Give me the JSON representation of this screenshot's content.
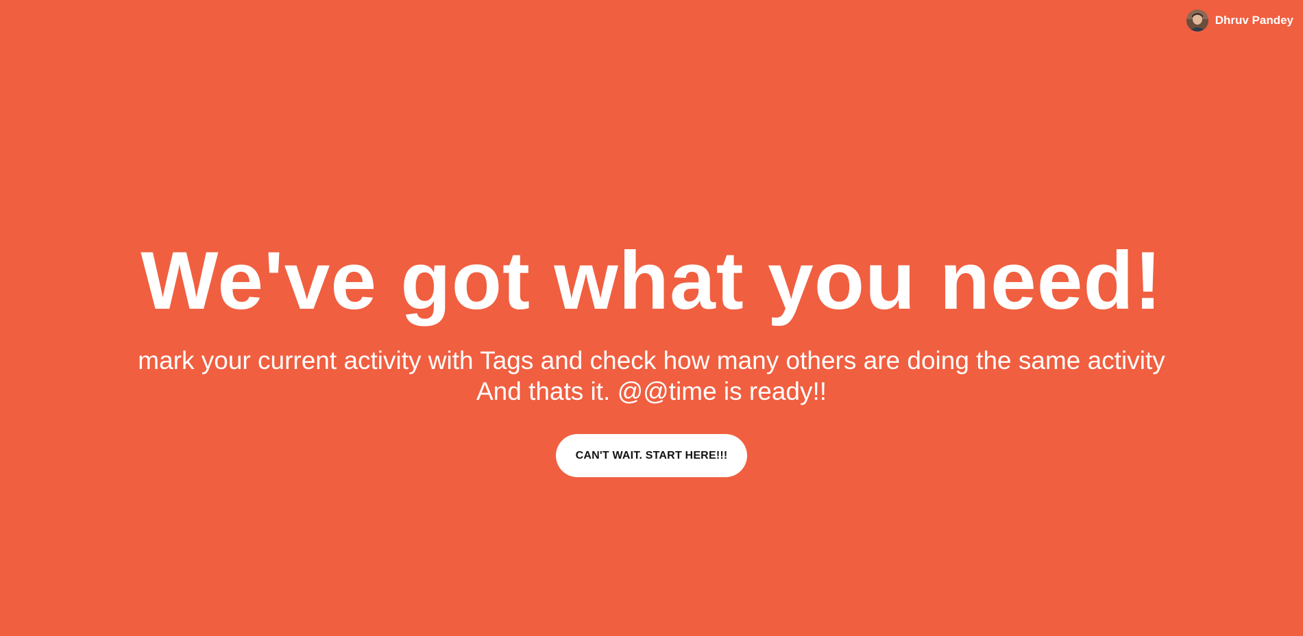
{
  "header": {
    "user": {
      "name": "Dhruv Pandey",
      "avatar_icon": "user-avatar-icon"
    }
  },
  "hero": {
    "title": "We've got what you need!",
    "subtitle_line1": "mark your current activity with Tags and check how many others are doing the same activity",
    "subtitle_line2": "And thats it. @@time is ready!!",
    "cta_label": "CAN'T WAIT. START HERE!!!"
  },
  "colors": {
    "background": "#f05f40",
    "text": "#ffffff",
    "cta_background": "#ffffff",
    "cta_text": "#111111"
  }
}
